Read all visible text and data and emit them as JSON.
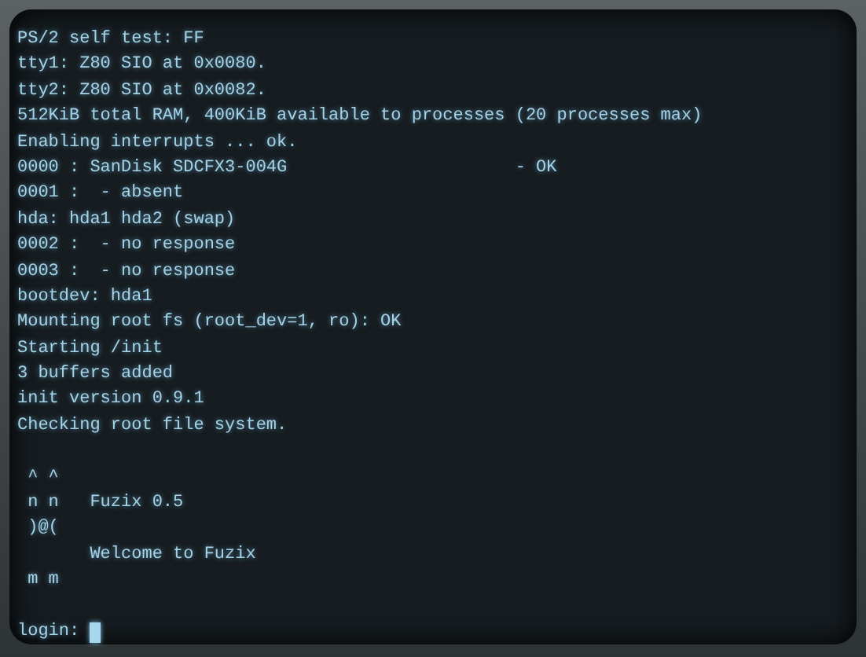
{
  "terminal": {
    "boot_log": [
      "PS/2 self test: FF",
      "tty1: Z80 SIO at 0x0080.",
      "tty2: Z80 SIO at 0x0082.",
      "512KiB total RAM, 400KiB available to processes (20 processes max)",
      "Enabling interrupts ... ok.",
      "0000 : SanDisk SDCFX3-004G                      - OK",
      "0001 :  - absent",
      "hda: hda1 hda2 (swap)",
      "0002 :  - no response",
      "0003 :  - no response",
      "bootdev: hda1",
      "Mounting root fs (root_dev=1, ro): OK",
      "Starting /init",
      "3 buffers added",
      "init version 0.9.1",
      "Checking root file system."
    ],
    "banner": [
      " ^ ^",
      " n n   Fuzix 0.5",
      " )@(",
      "       Welcome to Fuzix",
      " m m"
    ],
    "prompt": "login:"
  }
}
